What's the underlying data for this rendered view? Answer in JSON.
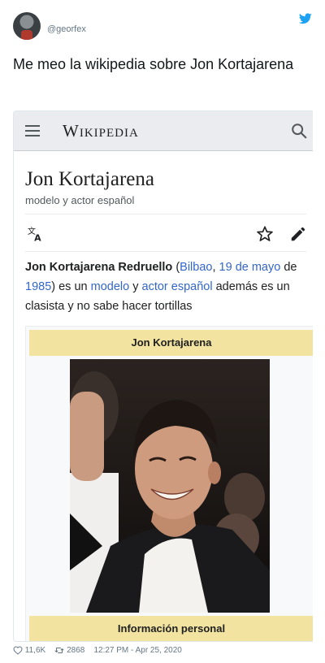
{
  "tweet": {
    "handle": "@georfex",
    "text": "Me meo la wikipedia sobre Jon Kortajarena",
    "likes": "11,6K",
    "retweets": "2868",
    "timestamp": "12:27 PM - Apr 25, 2020"
  },
  "wiki": {
    "logo": "Wikipedia",
    "title": "Jon Kortajarena",
    "subtitle": "modelo y actor español",
    "lead": {
      "bold_name": "Jon Kortajarena Redruello",
      "open_paren": " (",
      "link_place": "Bilbao",
      "comma": ", ",
      "link_date": "19 de mayo",
      "de": " de ",
      "link_year": "1985",
      "mid": ") es un ",
      "link_modelo": "modelo",
      "y": " y ",
      "link_actor": "actor español",
      "rest": " además es un clasista y no sabe hacer tortillas"
    },
    "infobox": {
      "header": "Jon Kortajarena",
      "footer": "Información personal"
    }
  },
  "colors": {
    "link": "#3366cc",
    "infobox_band": "#f3e3a0",
    "twitter_blue": "#1da1f2"
  },
  "icons": [
    "twitter-bird-icon",
    "hamburger-menu-icon",
    "search-icon",
    "translate-icon",
    "star-icon",
    "edit-pencil-icon",
    "heart-icon",
    "retweet-icon"
  ]
}
